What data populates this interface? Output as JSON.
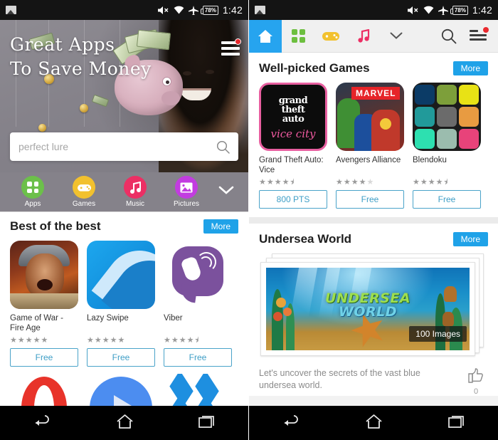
{
  "status_bar": {
    "photo_icon": "image-icon",
    "mute_icon": "volume-mute-icon",
    "wifi_icon": "wifi-icon",
    "airplane_icon": "airplane-mode-icon",
    "battery_label": "78%",
    "time": "1:42"
  },
  "left_screen": {
    "banner": {
      "title_line1": "Great Apps",
      "title_line2": "To Save Money",
      "menu_icon": "hamburger-menu-icon",
      "has_notification_dot": true
    },
    "search": {
      "placeholder": "perfect lure",
      "value": "",
      "icon": "search-icon"
    },
    "categories": [
      {
        "label": "Apps",
        "icon": "grid-apps-icon",
        "color": "#6cc04a"
      },
      {
        "label": "Games",
        "icon": "gamepad-icon",
        "color": "#f2c12e"
      },
      {
        "label": "Music",
        "icon": "music-note-icon",
        "color": "#ec2f64"
      },
      {
        "label": "Pictures",
        "icon": "picture-icon",
        "color": "#c23ce0"
      }
    ],
    "expand_icon": "chevron-down-icon",
    "section": {
      "title": "Best of the best",
      "more_label": "More",
      "apps": [
        {
          "name": "Game of War - Fire Age",
          "rating": 5,
          "price": "Free",
          "icon": "game-of-war-icon"
        },
        {
          "name": "Lazy Swipe",
          "rating": 5,
          "price": "Free",
          "icon": "lazy-swipe-icon"
        },
        {
          "name": "Viber",
          "rating": 4.5,
          "price": "Free",
          "icon": "viber-icon"
        }
      ],
      "apps_row2": [
        {
          "name": "Opera",
          "icon": "opera-icon"
        },
        {
          "name": "Play",
          "icon": "play-icon"
        },
        {
          "name": "Dropbox",
          "icon": "dropbox-icon"
        }
      ]
    }
  },
  "right_screen": {
    "nav": {
      "tabs": [
        {
          "name": "home",
          "icon": "home-icon",
          "active": true
        },
        {
          "name": "apps",
          "icon": "grid-apps-icon",
          "active": false
        },
        {
          "name": "games",
          "icon": "gamepad-icon",
          "active": false
        },
        {
          "name": "music",
          "icon": "music-note-icon",
          "active": false
        },
        {
          "name": "more",
          "icon": "chevron-down-icon",
          "active": false
        }
      ],
      "search_icon": "search-icon",
      "menu_icon": "hamburger-menu-icon",
      "has_notification_dot": true
    },
    "games_section": {
      "title": "Well-picked Games",
      "more_label": "More",
      "games": [
        {
          "name": "Grand Theft Auto: Vice",
          "rating": 4.5,
          "price": "800 PTS",
          "icon": "gta-vice-city-icon",
          "art": {
            "line1": "grand",
            "line2": "theft",
            "line3": "auto",
            "sub": "vice city"
          }
        },
        {
          "name": "Avengers Alliance",
          "rating": 4,
          "price": "Free",
          "icon": "avengers-alliance-icon",
          "art": {
            "brand": "MARVEL"
          }
        },
        {
          "name": "Blendoku",
          "rating": 4.5,
          "price": "Free",
          "icon": "blendoku-icon",
          "art": {
            "colors": [
              "#0b3b66",
              "#7d9f3a",
              "#e8e215",
              "#219a9a",
              "#6b6b6b",
              "#e89b41",
              "#2de0b0",
              "#9bbcae",
              "#e8437a"
            ]
          }
        }
      ]
    },
    "undersea_section": {
      "title": "Undersea World",
      "more_label": "More",
      "image_title_line1": "UNDERSEA",
      "image_title_line2": "WORLD",
      "image_count": "100 Images",
      "description": "Let's uncover the secrets of the vast blue undersea world.",
      "like_icon": "thumbs-up-icon",
      "like_count": "0"
    }
  },
  "android_nav": {
    "back_icon": "back-arrow-icon",
    "home_icon": "home-icon",
    "recents_icon": "recent-apps-icon"
  },
  "theme": {
    "accent_blue": "#26a4ef",
    "button_outline": "#4aa3c9",
    "status_bar_bg": "#141414"
  }
}
